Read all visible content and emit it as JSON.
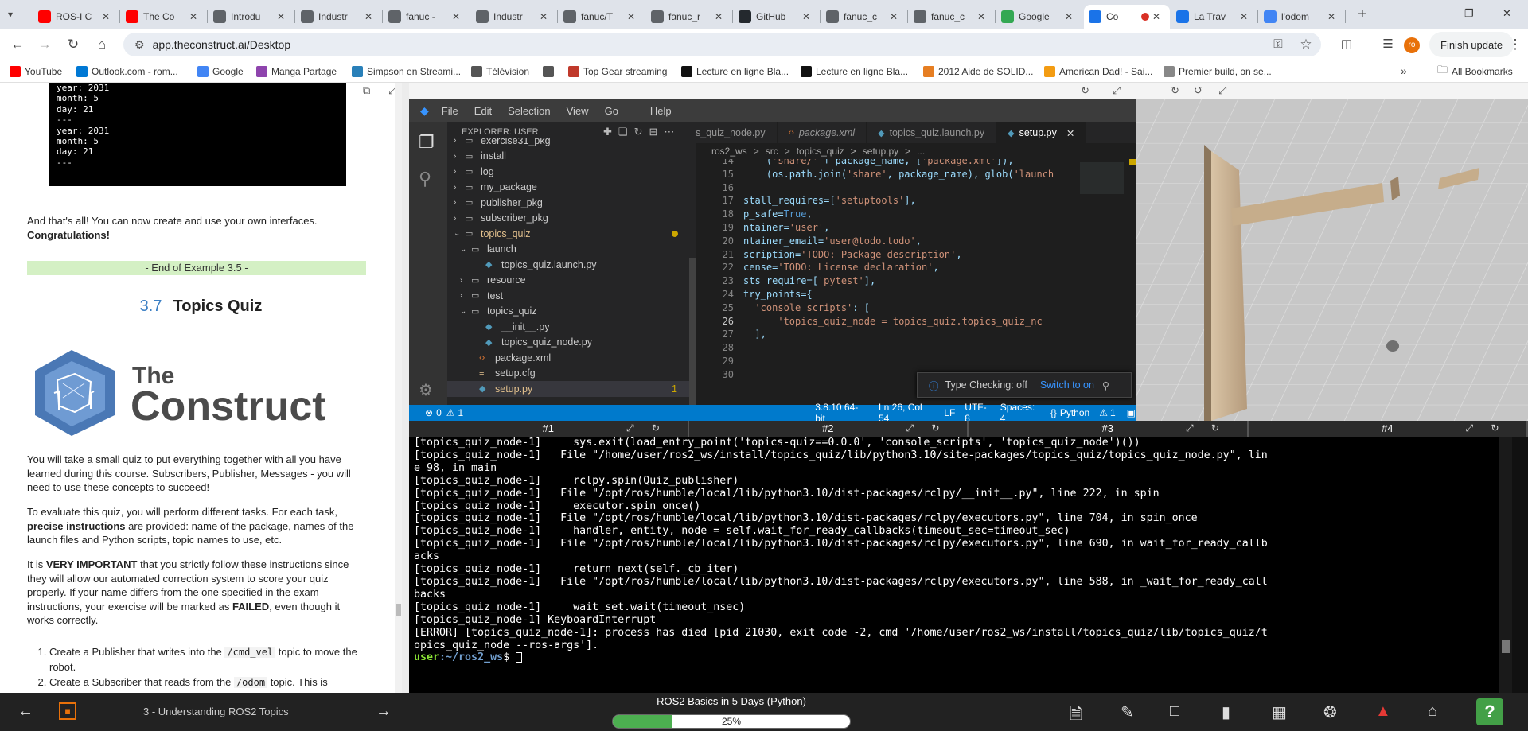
{
  "browser": {
    "tabs": [
      {
        "title": "ROS-I C",
        "favicon": "youtube-icon",
        "color": "#ff0000"
      },
      {
        "title": "The Co",
        "favicon": "youtube-icon",
        "color": "#ff0000"
      },
      {
        "title": "Introdu",
        "favicon": "doc-icon",
        "color": "#5f6368"
      },
      {
        "title": "Industr",
        "favicon": "grid-icon",
        "color": "#5f6368"
      },
      {
        "title": "fanuc -",
        "favicon": "grid-icon",
        "color": "#5f6368"
      },
      {
        "title": "Industr",
        "favicon": "grid-icon",
        "color": "#5f6368"
      },
      {
        "title": "fanuc/T",
        "favicon": "grid-icon",
        "color": "#5f6368"
      },
      {
        "title": "fanuc_r",
        "favicon": "grid-icon",
        "color": "#5f6368"
      },
      {
        "title": "GitHub",
        "favicon": "github-icon",
        "color": "#24292e"
      },
      {
        "title": "fanuc_c",
        "favicon": "grid-icon",
        "color": "#5f6368"
      },
      {
        "title": "fanuc_c",
        "favicon": "grid-icon",
        "color": "#5f6368"
      },
      {
        "title": "Google",
        "favicon": "maps-icon",
        "color": "#34a853"
      },
      {
        "title": "Co",
        "favicon": "construct-icon",
        "color": "#1a73e8"
      },
      {
        "title": "La Trav",
        "favicon": "mail-icon",
        "color": "#1a73e8"
      },
      {
        "title": "l'odom",
        "favicon": "google-icon",
        "color": "#4285f4"
      }
    ],
    "new_tab": "+",
    "url": "app.theconstruct.ai/Desktop",
    "finish_update": "Finish update",
    "profile_initials": "ro",
    "bookmarks": [
      {
        "label": "YouTube",
        "color": "#ff0000"
      },
      {
        "label": "Outlook.com - rom...",
        "color": "#0078d4"
      },
      {
        "label": "Google",
        "color": "#4285f4"
      },
      {
        "label": "Manga Partage",
        "color": "#8e44ad"
      },
      {
        "label": "Simpson en Streami...",
        "color": "#2980b9"
      },
      {
        "label": "Télévision",
        "color": "#555555"
      },
      {
        "label": "",
        "color": "#555555"
      },
      {
        "label": "Top Gear streaming",
        "color": "#c0392b"
      },
      {
        "label": "Lecture en ligne Bla...",
        "color": "#111111"
      },
      {
        "label": "Lecture en ligne Bla...",
        "color": "#111111"
      },
      {
        "label": "2012 Aide de SOLID...",
        "color": "#e67e22"
      },
      {
        "label": "American Dad! - Sai...",
        "color": "#f39c12"
      },
      {
        "label": "Premier build, on se...",
        "color": "#888888"
      }
    ],
    "all_bookmarks": "All Bookmarks"
  },
  "course": {
    "code_output": "year: 2031\nmonth: 5\nday: 21\n---\nyear: 2031\nmonth: 5\nday: 21\n---",
    "done_text": "And that's all! You can now create and use your own interfaces.",
    "congrats": "Congratulations!",
    "end_example": "- End of Example 3.5 -",
    "section_num": "3.7",
    "section_title": "Topics Quiz",
    "logo_line1": "The",
    "logo_line2": "Construct",
    "p1": "You will take a small quiz to put everything together with all you have learned during this course. Subscribers, Publisher, Messages - you will need to use these concepts to succeed!",
    "p2_a": "To evaluate this quiz, you will perform different tasks. For each task, ",
    "p2_b": "precise instructions",
    "p2_c": " are provided: name of the package, names of the launch files and Python scripts, topic names to use, etc.",
    "p3_a": "It is ",
    "p3_b": "VERY IMPORTANT",
    "p3_c": " that you strictly follow these instructions since they will allow our automated correction system to score your quiz properly. If your name differs from the one specified in the exam instructions, your exercise will be marked as ",
    "p3_d": "FAILED",
    "p3_e": ", even though it works correctly.",
    "li1_a": "Create a Publisher that writes into the ",
    "li1_code": "/cmd_vel",
    "li1_b": " topic to move the robot.",
    "li2_a": "Create a Subscriber that reads from the ",
    "li2_code": "/odom",
    "li2_b": " topic. This is"
  },
  "vscode": {
    "menu": [
      "File",
      "Edit",
      "Selection",
      "View",
      "Go",
      "Help"
    ],
    "explorer_title": "EXPLORER: USER",
    "tree": [
      {
        "label": "exercise31_pkg",
        "depth": 1,
        "kind": "folder",
        "open": false
      },
      {
        "label": "install",
        "depth": 1,
        "kind": "folder",
        "open": false
      },
      {
        "label": "log",
        "depth": 1,
        "kind": "folder",
        "open": false
      },
      {
        "label": "my_package",
        "depth": 1,
        "kind": "folder",
        "open": false
      },
      {
        "label": "publisher_pkg",
        "depth": 1,
        "kind": "folder",
        "open": false
      },
      {
        "label": "subscriber_pkg",
        "depth": 1,
        "kind": "folder",
        "open": false
      },
      {
        "label": "topics_quiz",
        "depth": 1,
        "kind": "folder",
        "open": true,
        "modified": true
      },
      {
        "label": "launch",
        "depth": 2,
        "kind": "folder",
        "open": true
      },
      {
        "label": "topics_quiz.launch.py",
        "depth": 3,
        "kind": "py"
      },
      {
        "label": "resource",
        "depth": 2,
        "kind": "folder",
        "open": false
      },
      {
        "label": "test",
        "depth": 2,
        "kind": "folder",
        "open": false
      },
      {
        "label": "topics_quiz",
        "depth": 2,
        "kind": "folder",
        "open": true
      },
      {
        "label": "__init__.py",
        "depth": 3,
        "kind": "py"
      },
      {
        "label": "topics_quiz_node.py",
        "depth": 3,
        "kind": "py"
      },
      {
        "label": "package.xml",
        "depth": 2,
        "kind": "xml"
      },
      {
        "label": "setup.cfg",
        "depth": 2,
        "kind": "cfg"
      },
      {
        "label": "setup.py",
        "depth": 2,
        "kind": "py",
        "selected": true,
        "badge": "1"
      }
    ],
    "editor_tabs": [
      {
        "label": "s_quiz_node.py",
        "kind": "py"
      },
      {
        "label": "package.xml",
        "kind": "xml"
      },
      {
        "label": "topics_quiz.launch.py",
        "kind": "py"
      },
      {
        "label": "setup.py",
        "kind": "py",
        "active": true
      }
    ],
    "breadcrumbs": [
      "ros2_ws",
      ">",
      "src",
      ">",
      "topics_quiz",
      ">",
      "setup.py",
      ">",
      "..."
    ],
    "code": [
      {
        "n": "14",
        "t": "    ('share/' + package_name, ['package.xml']),"
      },
      {
        "n": "15",
        "t": "    (os.path.join('share', package_name), glob('launch"
      },
      {
        "n": "16",
        "t": ""
      },
      {
        "n": "17",
        "t": "stall_requires=['setuptools'],"
      },
      {
        "n": "18",
        "t": "p_safe=True,"
      },
      {
        "n": "19",
        "t": "ntainer='user',"
      },
      {
        "n": "20",
        "t": "ntainer_email='user@todo.todo',"
      },
      {
        "n": "21",
        "t": "scription='TODO: Package description',"
      },
      {
        "n": "22",
        "t": "cense='TODO: License declaration',"
      },
      {
        "n": "23",
        "t": "sts_require=['pytest'],"
      },
      {
        "n": "24",
        "t": "try_points={"
      },
      {
        "n": "25",
        "t": "  'console_scripts': ["
      },
      {
        "n": "26",
        "t": "      'topics_quiz_node = topics_quiz.topics_quiz_nc"
      },
      {
        "n": "27",
        "t": "  ],"
      },
      {
        "n": "28",
        "t": ""
      },
      {
        "n": "29",
        "t": ""
      },
      {
        "n": "30",
        "t": ""
      }
    ],
    "notification": {
      "text": "Type Checking: off",
      "action": "Switch to on"
    },
    "status": {
      "errors": "0",
      "warnings": "1",
      "python": "3.8.10 64-bit",
      "position": "Ln 26, Col 54",
      "eol": "LF",
      "encoding": "UTF-8",
      "spaces": "Spaces: 4",
      "language": "Python",
      "problems": "1"
    }
  },
  "terminal": {
    "tabs": [
      "#1",
      "#2",
      "#3",
      "#4"
    ],
    "lines": [
      "[topics_quiz_node-1]     sys.exit(load_entry_point('topics-quiz==0.0.0', 'console_scripts', 'topics_quiz_node')())",
      "[topics_quiz_node-1]   File \"/home/user/ros2_ws/install/topics_quiz/lib/python3.10/site-packages/topics_quiz/topics_quiz_node.py\", lin",
      "e 98, in main",
      "[topics_quiz_node-1]     rclpy.spin(Quiz_publisher)",
      "[topics_quiz_node-1]   File \"/opt/ros/humble/local/lib/python3.10/dist-packages/rclpy/__init__.py\", line 222, in spin",
      "[topics_quiz_node-1]     executor.spin_once()",
      "[topics_quiz_node-1]   File \"/opt/ros/humble/local/lib/python3.10/dist-packages/rclpy/executors.py\", line 704, in spin_once",
      "[topics_quiz_node-1]     handler, entity, node = self.wait_for_ready_callbacks(timeout_sec=timeout_sec)",
      "[topics_quiz_node-1]   File \"/opt/ros/humble/local/lib/python3.10/dist-packages/rclpy/executors.py\", line 690, in wait_for_ready_callb",
      "acks",
      "[topics_quiz_node-1]     return next(self._cb_iter)",
      "[topics_quiz_node-1]   File \"/opt/ros/humble/local/lib/python3.10/dist-packages/rclpy/executors.py\", line 588, in _wait_for_ready_call",
      "backs",
      "[topics_quiz_node-1]     wait_set.wait(timeout_nsec)",
      "[topics_quiz_node-1] KeyboardInterrupt",
      "[ERROR] [topics_quiz_node-1]: process has died [pid 21030, exit code -2, cmd '/home/user/ros2_ws/install/topics_quiz/lib/topics_quiz/t",
      "opics_quiz_node --ros-args']."
    ],
    "prompt_user": "user",
    "prompt_path": ":~/ros2_ws",
    "prompt_sign": "$ "
  },
  "bottom": {
    "unit": "3 - Understanding ROS2 Topics",
    "course": "ROS2 Basics in 5 Days (Python)",
    "progress_label": "25%",
    "progress": 0.25
  }
}
